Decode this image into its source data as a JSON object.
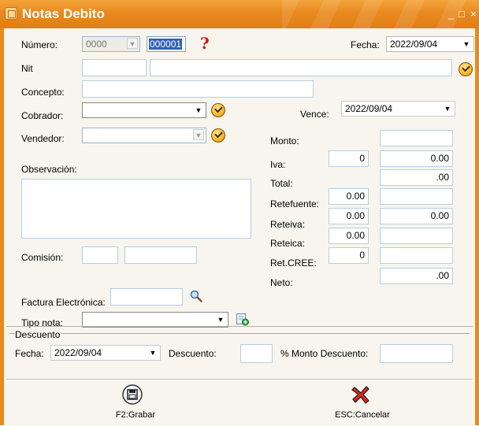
{
  "window": {
    "title": "Notas Debito",
    "minimize_glyph": "_",
    "maximize_glyph": "□",
    "close_glyph": "×"
  },
  "form": {
    "numero_label": "Número:",
    "numero_prefix": "0000",
    "numero_value": "000001",
    "fecha_label": "Fecha:",
    "fecha_value": "2022/09/04",
    "nit_label": "Nit",
    "concepto_label": "Concepto:",
    "cobrador_label": "Cobrador:",
    "vendedor_label": "Vendedor:",
    "vence_label": "Vence:",
    "vence_value": "2022/09/04",
    "observacion_label": "Observación:",
    "comision_label": "Comisión:",
    "factura_label": "Factura Electrónica:",
    "tipo_nota_label": "Tipo nota:"
  },
  "totals": {
    "monto_label": "Monto:",
    "iva_label": "Iva:",
    "iva_pct": "0",
    "iva_value": "0.00",
    "total_label": "Total:",
    "total_value": ".00",
    "retefuente_label": "Retefuente:",
    "retefuente_pct": "0.00",
    "reteiva_label": "Reteiva:",
    "reteiva_pct": "0.00",
    "reteiva_value": "0.00",
    "reteica_label": "Reteica:",
    "reteica_pct": "0.00",
    "retcree_label": "Ret.CREE:",
    "retcree_pct": "0",
    "neto_label": "Neto:",
    "neto_value": ".00"
  },
  "descuento": {
    "group_label": "Descuento",
    "fecha_label": "Fecha:",
    "fecha_value": "2022/09/04",
    "descuento_label": "Descuento:",
    "monto_descuento_label": "% Monto Descuento:"
  },
  "toolbar": {
    "save_label": "F2:Grabar",
    "cancel_label": "ESC:Cancelar"
  },
  "icons": {
    "lookup": "checkmark-circle-icon",
    "help": "question-mark-icon",
    "search": "magnifier-icon",
    "add": "add-document-icon",
    "save": "floppy-disk-icon",
    "cancel": "red-x-icon"
  },
  "colors": {
    "title_bar": "#e8891f",
    "selection": "#2f62b6",
    "field_border": "#b5cfe0"
  }
}
